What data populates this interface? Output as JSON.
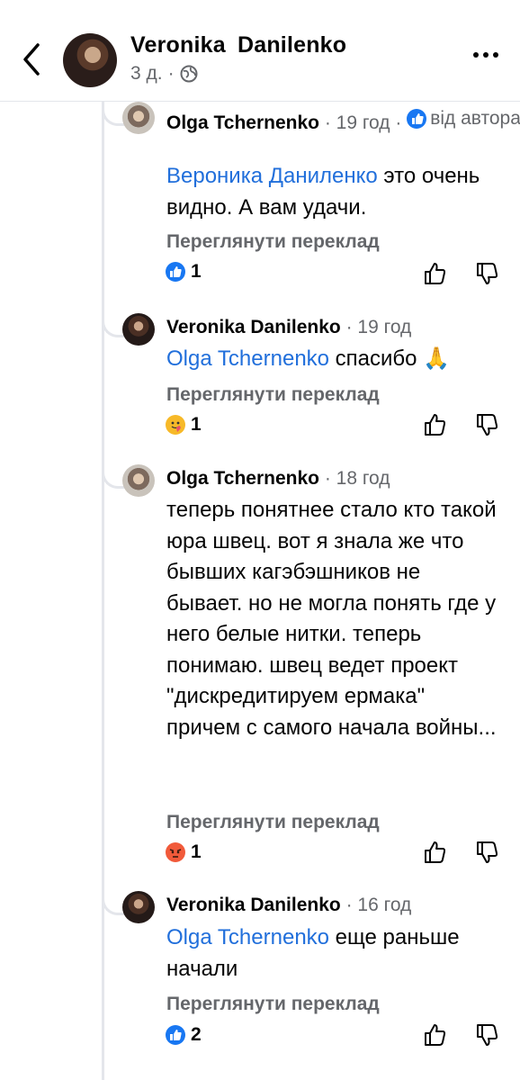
{
  "header": {
    "name": "Veronika  Danilenko",
    "time": "3 д.",
    "dot": "·",
    "privacy_icon": "globe-icon"
  },
  "comments": [
    {
      "author": "Olga Tchernenko",
      "meta": "· 19 год ·",
      "badge_icon": "like-badge-icon",
      "tag": "від автора",
      "mention": "Вероника Даниленко",
      "text": " это очень видно. А вам удачи.",
      "translate": "Переглянути переклад",
      "reaction_icon": "like-reaction-icon",
      "reaction_count": "1"
    },
    {
      "author": "Veronika  Danilenko",
      "meta": "· 19 год",
      "mention": "Olga Tchernenko",
      "text": " спасибо 🙏",
      "translate": "Переглянути переклад",
      "reaction_icon": "care-reaction-icon",
      "reaction_count": "1"
    },
    {
      "author": "Olga Tchernenko",
      "meta": "· 18 год",
      "text": "теперь понятнее стало кто такой юра швец. вот я знала же что бывших кагэбэшников не бывает. но не могла понять где у него белые нитки. теперь понимаю. швец ведет проект \"дискредитируем ермака\" причем с самого начала войны...",
      "translate": "Переглянути переклад",
      "reaction_icon": "angry-reaction-icon",
      "reaction_count": "1"
    },
    {
      "author": "Veronika  Danilenko",
      "meta": "· 16 год",
      "mention": "Olga Tchernenko",
      "text": " еще раньше начали",
      "translate": "Переглянути переклад",
      "reaction_icon": "like-reaction-icon",
      "reaction_count": "2"
    }
  ]
}
